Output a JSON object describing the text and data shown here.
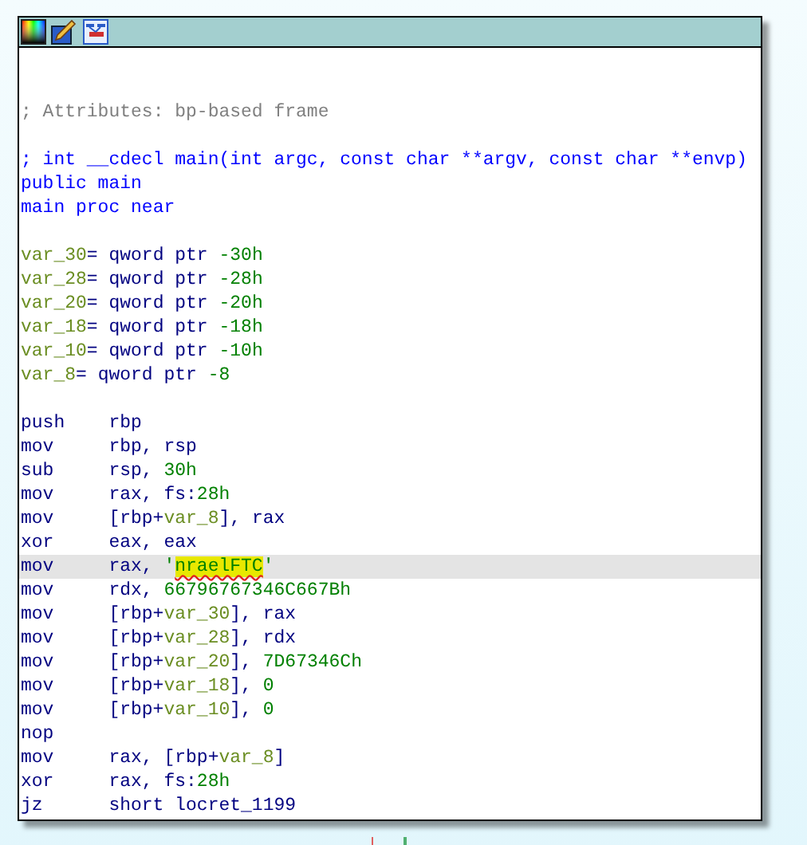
{
  "node": {
    "blocks": [
      [
        {
          "parts": [
            {
              "text": "; Attributes: bp-based frame",
              "kind": "comment"
            }
          ]
        }
      ],
      [
        {
          "parts": [
            {
              "text": "; int __cdecl main(int argc, const char **argv, const char **envp)",
              "kind": "keyword"
            }
          ]
        },
        {
          "parts": [
            {
              "text": "public main",
              "kind": "keyword"
            }
          ]
        },
        {
          "parts": [
            {
              "text": "main proc near",
              "kind": "keyword"
            }
          ]
        }
      ],
      [
        {
          "parts": [
            {
              "text": "var_30",
              "kind": "name"
            },
            {
              "text": "= qword ptr ",
              "kind": "text"
            },
            {
              "text": "-30h",
              "kind": "number"
            }
          ]
        },
        {
          "parts": [
            {
              "text": "var_28",
              "kind": "name"
            },
            {
              "text": "= qword ptr ",
              "kind": "text"
            },
            {
              "text": "-28h",
              "kind": "number"
            }
          ]
        },
        {
          "parts": [
            {
              "text": "var_20",
              "kind": "name"
            },
            {
              "text": "= qword ptr ",
              "kind": "text"
            },
            {
              "text": "-20h",
              "kind": "number"
            }
          ]
        },
        {
          "parts": [
            {
              "text": "var_18",
              "kind": "name"
            },
            {
              "text": "= qword ptr ",
              "kind": "text"
            },
            {
              "text": "-18h",
              "kind": "number"
            }
          ]
        },
        {
          "parts": [
            {
              "text": "var_10",
              "kind": "name"
            },
            {
              "text": "= qword ptr ",
              "kind": "text"
            },
            {
              "text": "-10h",
              "kind": "number"
            }
          ]
        },
        {
          "parts": [
            {
              "text": "var_8",
              "kind": "name"
            },
            {
              "text": "= qword ptr ",
              "kind": "text"
            },
            {
              "text": "-8",
              "kind": "number"
            }
          ]
        }
      ],
      [
        {
          "mnemonic": "push",
          "parts": [
            {
              "text": "rbp",
              "kind": "text"
            }
          ]
        },
        {
          "mnemonic": "mov",
          "parts": [
            {
              "text": "rbp, rsp",
              "kind": "text"
            }
          ]
        },
        {
          "mnemonic": "sub",
          "parts": [
            {
              "text": "rsp, ",
              "kind": "text"
            },
            {
              "text": "30h",
              "kind": "number"
            }
          ]
        },
        {
          "mnemonic": "mov",
          "parts": [
            {
              "text": "rax, fs:",
              "kind": "text"
            },
            {
              "text": "28h",
              "kind": "number"
            }
          ]
        },
        {
          "mnemonic": "mov",
          "parts": [
            {
              "text": "[rbp+",
              "kind": "text"
            },
            {
              "text": "var_8",
              "kind": "name"
            },
            {
              "text": "], rax",
              "kind": "text"
            }
          ]
        },
        {
          "mnemonic": "xor",
          "parts": [
            {
              "text": "eax, eax",
              "kind": "text"
            }
          ]
        },
        {
          "mnemonic": "mov",
          "selected": true,
          "parts": [
            {
              "text": "rax, ",
              "kind": "text"
            },
            {
              "text": "'",
              "kind": "number"
            },
            {
              "text": "nraelFTC",
              "kind": "string",
              "highlighted": true
            },
            {
              "text": "'",
              "kind": "number"
            }
          ]
        },
        {
          "mnemonic": "mov",
          "parts": [
            {
              "text": "rdx, ",
              "kind": "text"
            },
            {
              "text": "66796767346C667Bh",
              "kind": "number"
            }
          ]
        },
        {
          "mnemonic": "mov",
          "parts": [
            {
              "text": "[rbp+",
              "kind": "text"
            },
            {
              "text": "var_30",
              "kind": "name"
            },
            {
              "text": "], rax",
              "kind": "text"
            }
          ]
        },
        {
          "mnemonic": "mov",
          "parts": [
            {
              "text": "[rbp+",
              "kind": "text"
            },
            {
              "text": "var_28",
              "kind": "name"
            },
            {
              "text": "], rdx",
              "kind": "text"
            }
          ]
        },
        {
          "mnemonic": "mov",
          "parts": [
            {
              "text": "[rbp+",
              "kind": "text"
            },
            {
              "text": "var_20",
              "kind": "name"
            },
            {
              "text": "], ",
              "kind": "text"
            },
            {
              "text": "7D67346Ch",
              "kind": "number"
            }
          ]
        },
        {
          "mnemonic": "mov",
          "parts": [
            {
              "text": "[rbp+",
              "kind": "text"
            },
            {
              "text": "var_18",
              "kind": "name"
            },
            {
              "text": "], ",
              "kind": "text"
            },
            {
              "text": "0",
              "kind": "number"
            }
          ]
        },
        {
          "mnemonic": "mov",
          "parts": [
            {
              "text": "[rbp+",
              "kind": "text"
            },
            {
              "text": "var_10",
              "kind": "name"
            },
            {
              "text": "], ",
              "kind": "text"
            },
            {
              "text": "0",
              "kind": "number"
            }
          ]
        },
        {
          "mnemonic": "nop"
        },
        {
          "mnemonic": "mov",
          "parts": [
            {
              "text": "rax, [rbp+",
              "kind": "text"
            },
            {
              "text": "var_8",
              "kind": "name"
            },
            {
              "text": "]",
              "kind": "text"
            }
          ]
        },
        {
          "mnemonic": "xor",
          "parts": [
            {
              "text": "rax, fs:",
              "kind": "text"
            },
            {
              "text": "28h",
              "kind": "number"
            }
          ]
        },
        {
          "mnemonic": "jz",
          "parts": [
            {
              "text": "short locret_1199",
              "kind": "text"
            }
          ]
        }
      ]
    ]
  }
}
